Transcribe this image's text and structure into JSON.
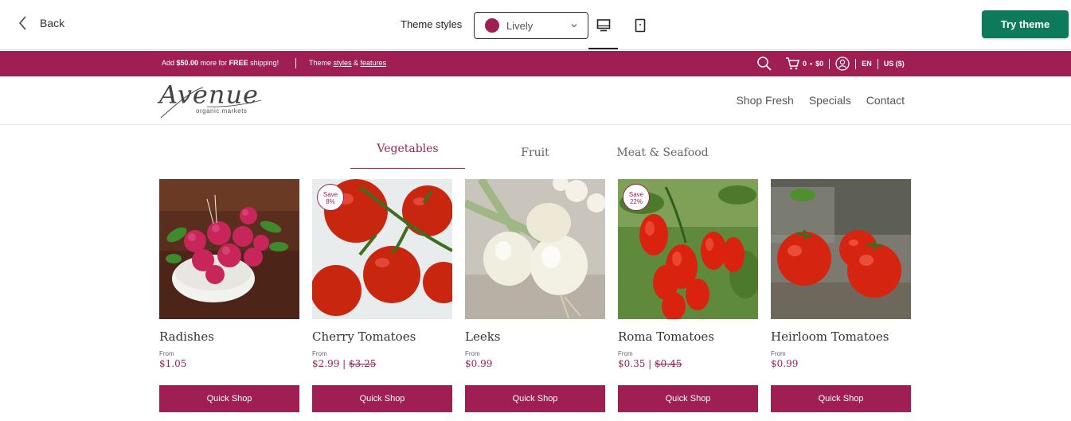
{
  "editor": {
    "back_label": "Back",
    "theme_styles_label": "Theme styles",
    "selected_style": "Lively",
    "style_swatch_color": "#9f1f54",
    "try_theme_label": "Try theme",
    "accent_color": "#0e7a5c",
    "active_device": "desktop"
  },
  "announcement": {
    "shipping_prefix": "Add ",
    "shipping_amount": "$50.00",
    "shipping_middle": " more for ",
    "shipping_free": "FREE",
    "shipping_suffix": " shipping!",
    "theme_prefix": "Theme ",
    "styles_link": "styles",
    "amp": " & ",
    "features_link": "features",
    "cart_count": "0",
    "cart_total": "$0",
    "language": "EN",
    "currency": "US ($)",
    "bar_color": "#9f1f54"
  },
  "store": {
    "logo_text": "Avenue",
    "logo_sub": "organic markets",
    "nav": [
      "Shop Fresh",
      "Specials",
      "Contact"
    ]
  },
  "tabs": [
    {
      "label": "Vegetables",
      "active": true
    },
    {
      "label": "Fruit",
      "active": false
    },
    {
      "label": "Meat & Seafood",
      "active": false
    }
  ],
  "products": [
    {
      "name": "Radishes",
      "from": "From",
      "price": "$1.05",
      "was": "",
      "badge": "",
      "button": "Quick Shop"
    },
    {
      "name": "Cherry Tomatoes",
      "from": "From",
      "price": "$2.99",
      "was": "$3.25",
      "badge": "Save 8%",
      "badge_line1": "Save",
      "badge_line2": "8%",
      "button": "Quick Shop"
    },
    {
      "name": "Leeks",
      "from": "From",
      "price": "$0.99",
      "was": "",
      "badge": "",
      "button": "Quick Shop"
    },
    {
      "name": "Roma Tomatoes",
      "from": "From",
      "price": "$0.35",
      "was": "$0.45",
      "badge": "Save 22%",
      "badge_line1": "Save",
      "badge_line2": "22%",
      "button": "Quick Shop"
    },
    {
      "name": "Heirloom Tomatoes",
      "from": "From",
      "price": "$0.99",
      "was": "",
      "badge": "",
      "button": "Quick Shop"
    }
  ]
}
